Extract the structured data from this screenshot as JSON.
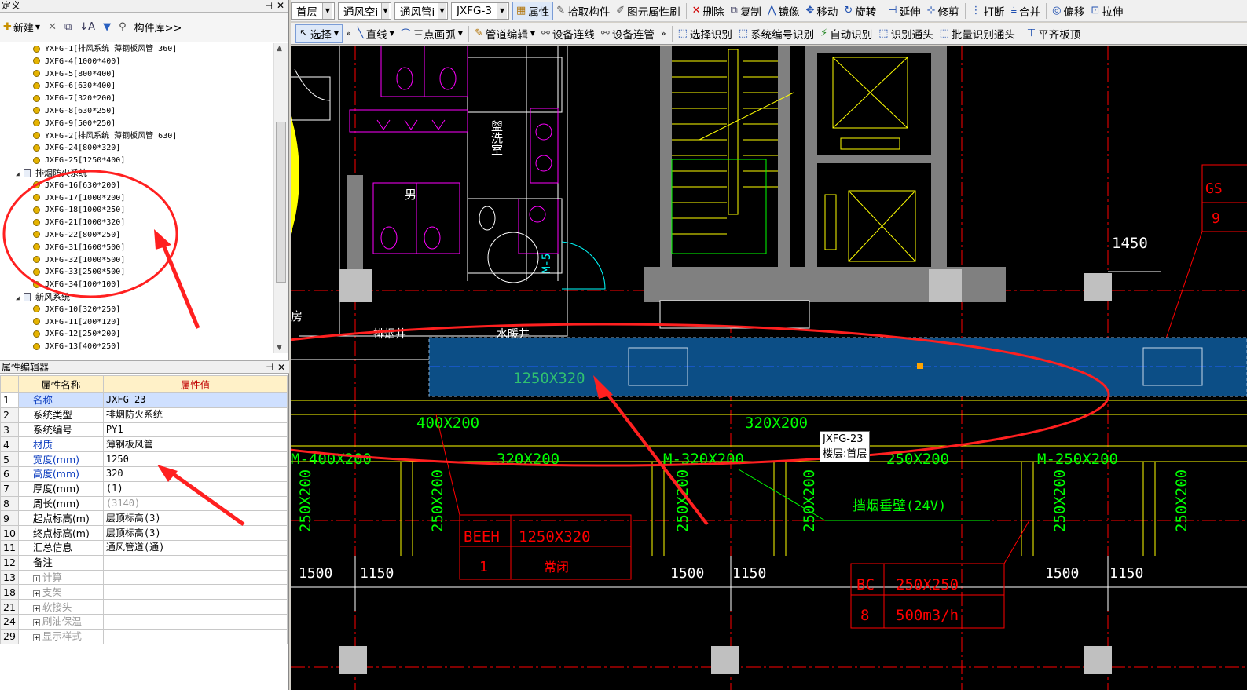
{
  "left_panel": {
    "title": "定义",
    "new_label": "新建",
    "library_label": "构件库>>",
    "tree": [
      {
        "label": "YXFG-1[排风系统 薄钢板风管 360]",
        "type": "item"
      },
      {
        "label": "JXFG-4[1000*400]",
        "type": "item"
      },
      {
        "label": "JXFG-5[800*400]",
        "type": "item"
      },
      {
        "label": "JXFG-6[630*400]",
        "type": "item"
      },
      {
        "label": "JXFG-7[320*200]",
        "type": "item"
      },
      {
        "label": "JXFG-8[630*250]",
        "type": "item"
      },
      {
        "label": "JXFG-9[500*250]",
        "type": "item"
      },
      {
        "label": "YXFG-2[排风系统 薄钢板风管 630]",
        "type": "item"
      },
      {
        "label": "JXFG-24[800*320]",
        "type": "item"
      },
      {
        "label": "JXFG-25[1250*400]",
        "type": "item"
      },
      {
        "label": "排烟防火系统",
        "type": "group"
      },
      {
        "label": "JXFG-16[630*200]",
        "type": "item"
      },
      {
        "label": "JXFG-17[1000*200]",
        "type": "item"
      },
      {
        "label": "JXFG-18[1000*250]",
        "type": "item"
      },
      {
        "label": "JXFG-21[1000*320]",
        "type": "item"
      },
      {
        "label": "JXFG-22[800*250]",
        "type": "item"
      },
      {
        "label": "JXFG-31[1600*500]",
        "type": "item"
      },
      {
        "label": "JXFG-32[1000*500]",
        "type": "item"
      },
      {
        "label": "JXFG-33[2500*500]",
        "type": "item"
      },
      {
        "label": "JXFG-34[100*100]",
        "type": "item"
      },
      {
        "label": "新风系统",
        "type": "group"
      },
      {
        "label": "JXFG-10[320*250]",
        "type": "item"
      },
      {
        "label": "JXFG-11[200*120]",
        "type": "item"
      },
      {
        "label": "JXFG-12[250*200]",
        "type": "item"
      },
      {
        "label": "JXFG-13[400*250]",
        "type": "item"
      }
    ]
  },
  "property_editor": {
    "title": "属性编辑器",
    "col_name": "属性名称",
    "col_value": "属性值",
    "rows": [
      {
        "n": "1",
        "name": "名称",
        "value": "JXFG-23",
        "style": "blue",
        "selected": true
      },
      {
        "n": "2",
        "name": "系统类型",
        "value": "排烟防火系统",
        "style": "normal"
      },
      {
        "n": "3",
        "name": "系统编号",
        "value": "PY1",
        "style": "normal"
      },
      {
        "n": "4",
        "name": "材质",
        "value": "薄钢板风管",
        "style": "blue"
      },
      {
        "n": "5",
        "name": "宽度(mm)",
        "value": "1250",
        "style": "blue"
      },
      {
        "n": "6",
        "name": "高度(mm)",
        "value": "320",
        "style": "blue"
      },
      {
        "n": "7",
        "name": "厚度(mm)",
        "value": "(1)",
        "style": "normal"
      },
      {
        "n": "8",
        "name": "周长(mm)",
        "value": "(3140)",
        "style": "grayval"
      },
      {
        "n": "9",
        "name": "起点标高(m)",
        "value": "层顶标高(3)",
        "style": "normal"
      },
      {
        "n": "10",
        "name": "终点标高(m)",
        "value": "层顶标高(3)",
        "style": "normal"
      },
      {
        "n": "11",
        "name": "汇总信息",
        "value": "通风管道(通)",
        "style": "normal"
      },
      {
        "n": "12",
        "name": "备注",
        "value": "",
        "style": "normal"
      },
      {
        "n": "13",
        "name": "计算",
        "value": "",
        "style": "group"
      },
      {
        "n": "18",
        "name": "支架",
        "value": "",
        "style": "group"
      },
      {
        "n": "21",
        "name": "软接头",
        "value": "",
        "style": "group"
      },
      {
        "n": "24",
        "name": "刷油保温",
        "value": "",
        "style": "group"
      },
      {
        "n": "29",
        "name": "显示样式",
        "value": "",
        "style": "group"
      }
    ]
  },
  "toolbar1": {
    "floor": "首层",
    "system": "通风空i",
    "type": "通风管i",
    "component": "JXFG-3",
    "buttons": [
      "属性",
      "拾取构件",
      "图元属性刷",
      "删除",
      "复制",
      "镜像",
      "移动",
      "旋转",
      "延伸",
      "修剪",
      "打断",
      "合并",
      "偏移",
      "拉伸"
    ]
  },
  "toolbar2": {
    "buttons": [
      "选择",
      "直线",
      "三点画弧",
      "管道编辑",
      "设备连线",
      "设备连管",
      "选择识别",
      "系统编号识别",
      "自动识别",
      "识别通头",
      "批量识别通头",
      "平齐板顶"
    ]
  },
  "cad": {
    "tooltip_name": "JXFG-23",
    "tooltip_floor": "楼层:首层",
    "duct_label": "1250X320",
    "labels": {
      "d1": "400X200",
      "d2": "320X200",
      "d3": "M-400X200",
      "d4": "320X200",
      "d5": "M-320X200",
      "d6": "250X200",
      "d7": "M-250X200",
      "v1": "250X200",
      "v2": "250X200",
      "v3": "250X200",
      "v4": "250X200",
      "v5": "250X200",
      "v6": "250X200",
      "dim1": "1450",
      "dim2": "1500",
      "dim3": "1150",
      "dim4": "1500",
      "dim5": "1150",
      "dim6": "1500",
      "dim7": "1150",
      "smoke_wall": "挡烟垂壁(24V)",
      "beeh": "BEEH",
      "beeh_size": "1250X320",
      "beeh_num": "1",
      "beeh_state": "常闭",
      "bc": "BC",
      "bc_size": "250X250",
      "bc_num": "8",
      "bc_flow": "500m3/h",
      "gs": "GS",
      "gs_num": "9",
      "m5": "M-5",
      "wash": "盥洗室",
      "male": "男",
      "smoke_shaft": "排烟井",
      "water_shaft": "水暖井",
      "fang": "房"
    }
  }
}
